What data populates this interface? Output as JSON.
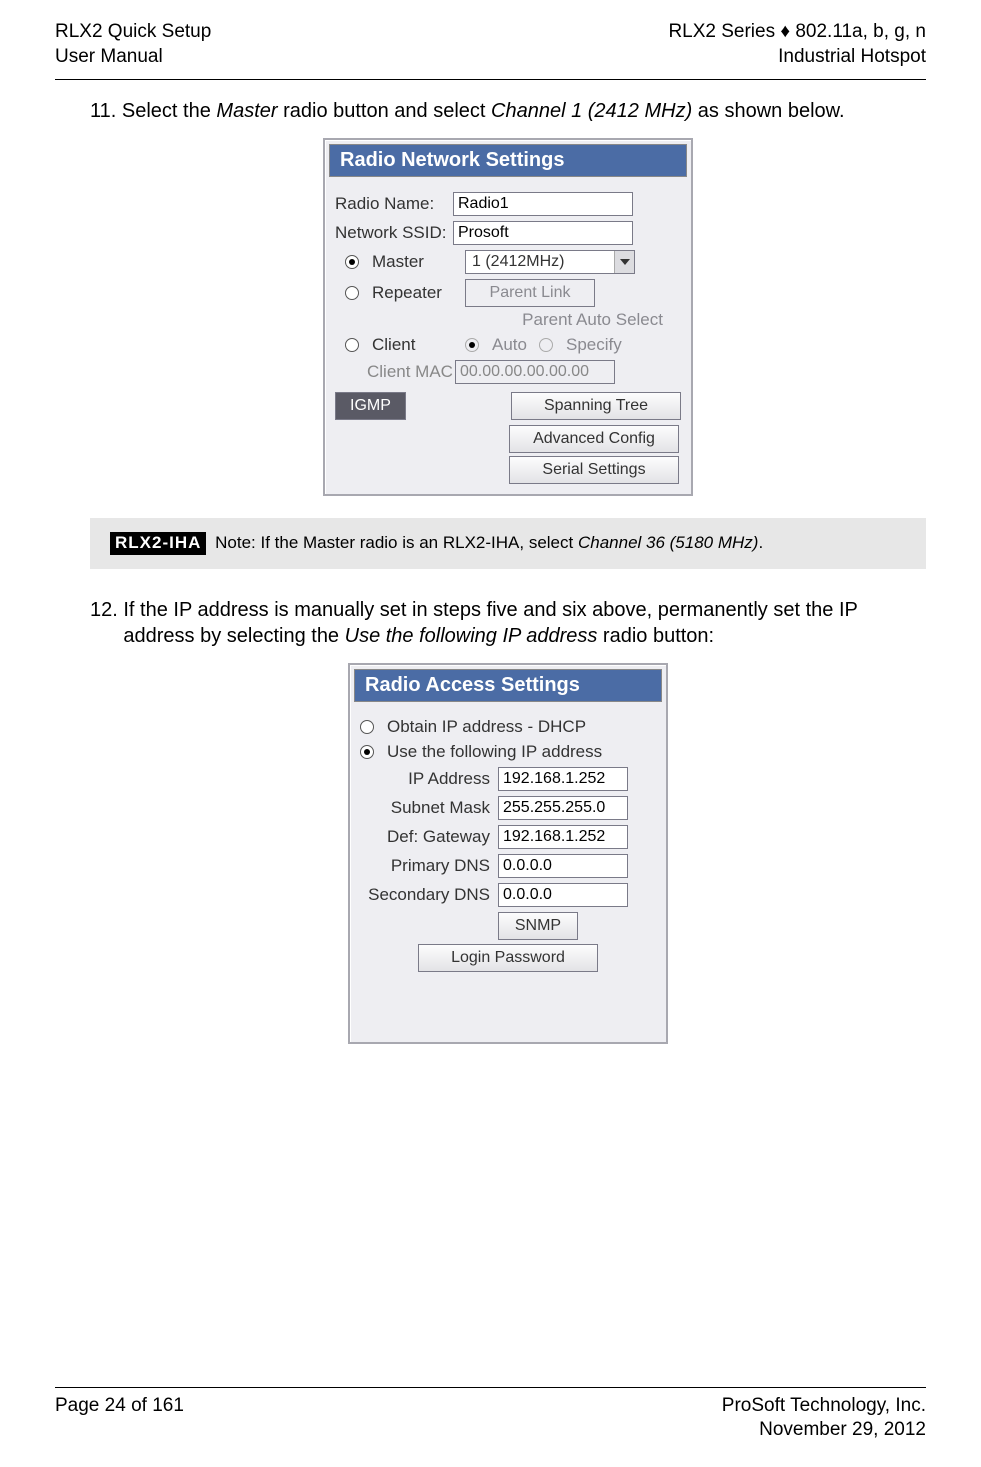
{
  "header": {
    "left_line1": "RLX2 Quick Setup",
    "left_line2": "User Manual",
    "right_line1": "RLX2 Series ♦ 802.11a, b, g, n",
    "right_line2": "Industrial Hotspot"
  },
  "step11": {
    "number": "11.",
    "text_part1": "Select the ",
    "master_italic": "Master",
    "text_part2": " radio button and select ",
    "channel_italic": "Channel 1 (2412 MHz)",
    "text_part3": " as shown below."
  },
  "net_panel": {
    "title": "Radio Network Settings",
    "radio_name_label": "Radio Name:",
    "radio_name_value": "Radio1",
    "ssid_label": "Network SSID:",
    "ssid_value": "Prosoft",
    "master_label": "Master",
    "channel_value": "1 (2412MHz)",
    "repeater_label": "Repeater",
    "parent_link_btn": "Parent Link",
    "parent_auto_text": "Parent Auto Select",
    "client_label": "Client",
    "auto_label": "Auto",
    "specify_label": "Specify",
    "client_mac_label": "Client MAC",
    "client_mac_value": "00.00.00.00.00.00",
    "igmp_btn": "IGMP",
    "spanning_btn": "Spanning Tree",
    "advanced_btn": "Advanced Config",
    "serial_btn": "Serial Settings"
  },
  "note": {
    "badge": "RLX2-IHA",
    "text_part1": " Note: If the Master radio is an RLX2-IHA, select ",
    "channel_italic": "Channel 36 (5180 MHz)",
    "text_part2": "."
  },
  "step12": {
    "number": "12.",
    "text_part1": "If the IP address is manually set in steps five and six above, permanently set the IP address by selecting the ",
    "use_ip_italic": "Use the following IP address",
    "text_part2": " radio button:"
  },
  "ip_panel": {
    "title": "Radio Access Settings",
    "dhcp_label": "Obtain IP address - DHCP",
    "use_ip_label": "Use the following IP address",
    "ip_label": "IP Address",
    "ip_value": "192.168.1.252",
    "subnet_label": "Subnet Mask",
    "subnet_value": "255.255.255.0",
    "gateway_label": "Def: Gateway",
    "gateway_value": "192.168.1.252",
    "pdns_label": "Primary DNS",
    "pdns_value": "0.0.0.0",
    "sdns_label": "Secondary DNS",
    "sdns_value": "0.0.0.0",
    "snmp_btn": "SNMP",
    "login_btn": "Login Password"
  },
  "footer": {
    "left": "Page 24 of 161",
    "right_line1": "ProSoft Technology, Inc.",
    "right_line2": "November 29, 2012"
  }
}
